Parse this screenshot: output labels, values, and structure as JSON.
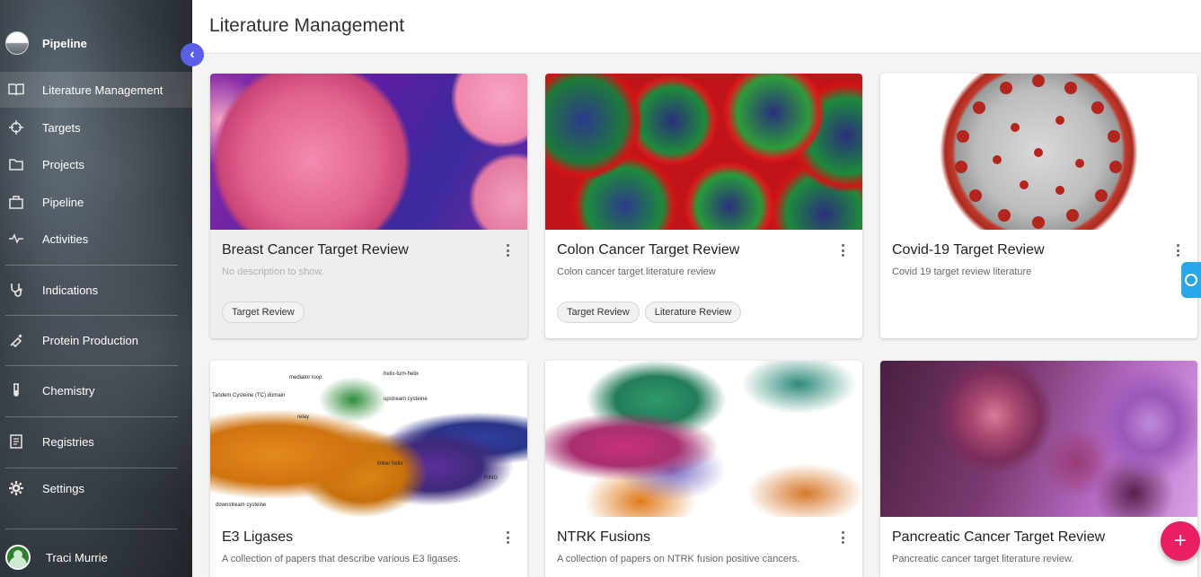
{
  "app": {
    "name": "Pipeline"
  },
  "sidebar": {
    "items": [
      {
        "label": "Literature Management",
        "icon": "book-icon"
      },
      {
        "label": "Targets",
        "icon": "crosshair-icon"
      },
      {
        "label": "Projects",
        "icon": "folder-icon"
      },
      {
        "label": "Pipeline",
        "icon": "briefcase-icon"
      },
      {
        "label": "Activities",
        "icon": "pulse-icon"
      },
      {
        "label": "Indications",
        "icon": "stethoscope-icon"
      },
      {
        "label": "Protein Production",
        "icon": "syringe-icon"
      },
      {
        "label": "Chemistry",
        "icon": "test-tube-icon"
      },
      {
        "label": "Registries",
        "icon": "document-list-icon"
      },
      {
        "label": "Settings",
        "icon": "gear-icon"
      }
    ],
    "active_index": 0
  },
  "user": {
    "name": "Traci Murrie"
  },
  "header": {
    "title": "Literature Management"
  },
  "cards": [
    {
      "title": "Breast Cancer Target Review",
      "description": "No description to show.",
      "tags": [
        "Target Review"
      ]
    },
    {
      "title": "Colon Cancer Target Review",
      "description": "Colon cancer target literature review",
      "tags": [
        "Target Review",
        "Literature Review"
      ]
    },
    {
      "title": "Covid-19 Target Review",
      "description": "Covid 19 target review literature",
      "tags": []
    },
    {
      "title": "E3 Ligases",
      "description": "A collection of papers that describe various E3 ligases.",
      "tags": [],
      "image_labels": [
        "mediator loop",
        "helix-turn-helix",
        "Tandem Cysteine (TC) domain",
        "upstream cysteine",
        "relay",
        "linker helix",
        "RING",
        "downstream cysteine"
      ]
    },
    {
      "title": "NTRK Fusions",
      "description": "A collection of papers on NTRK fusion positive cancers.",
      "tags": []
    },
    {
      "title": "Pancreatic Cancer Target Review",
      "description": "Pancreatic cancer target literature review.",
      "tags": []
    }
  ],
  "fab": {
    "label": "+"
  },
  "colors": {
    "fab": "#e91e63",
    "collapse": "#5b5fe6",
    "help_tab": "#2aa7e8"
  }
}
